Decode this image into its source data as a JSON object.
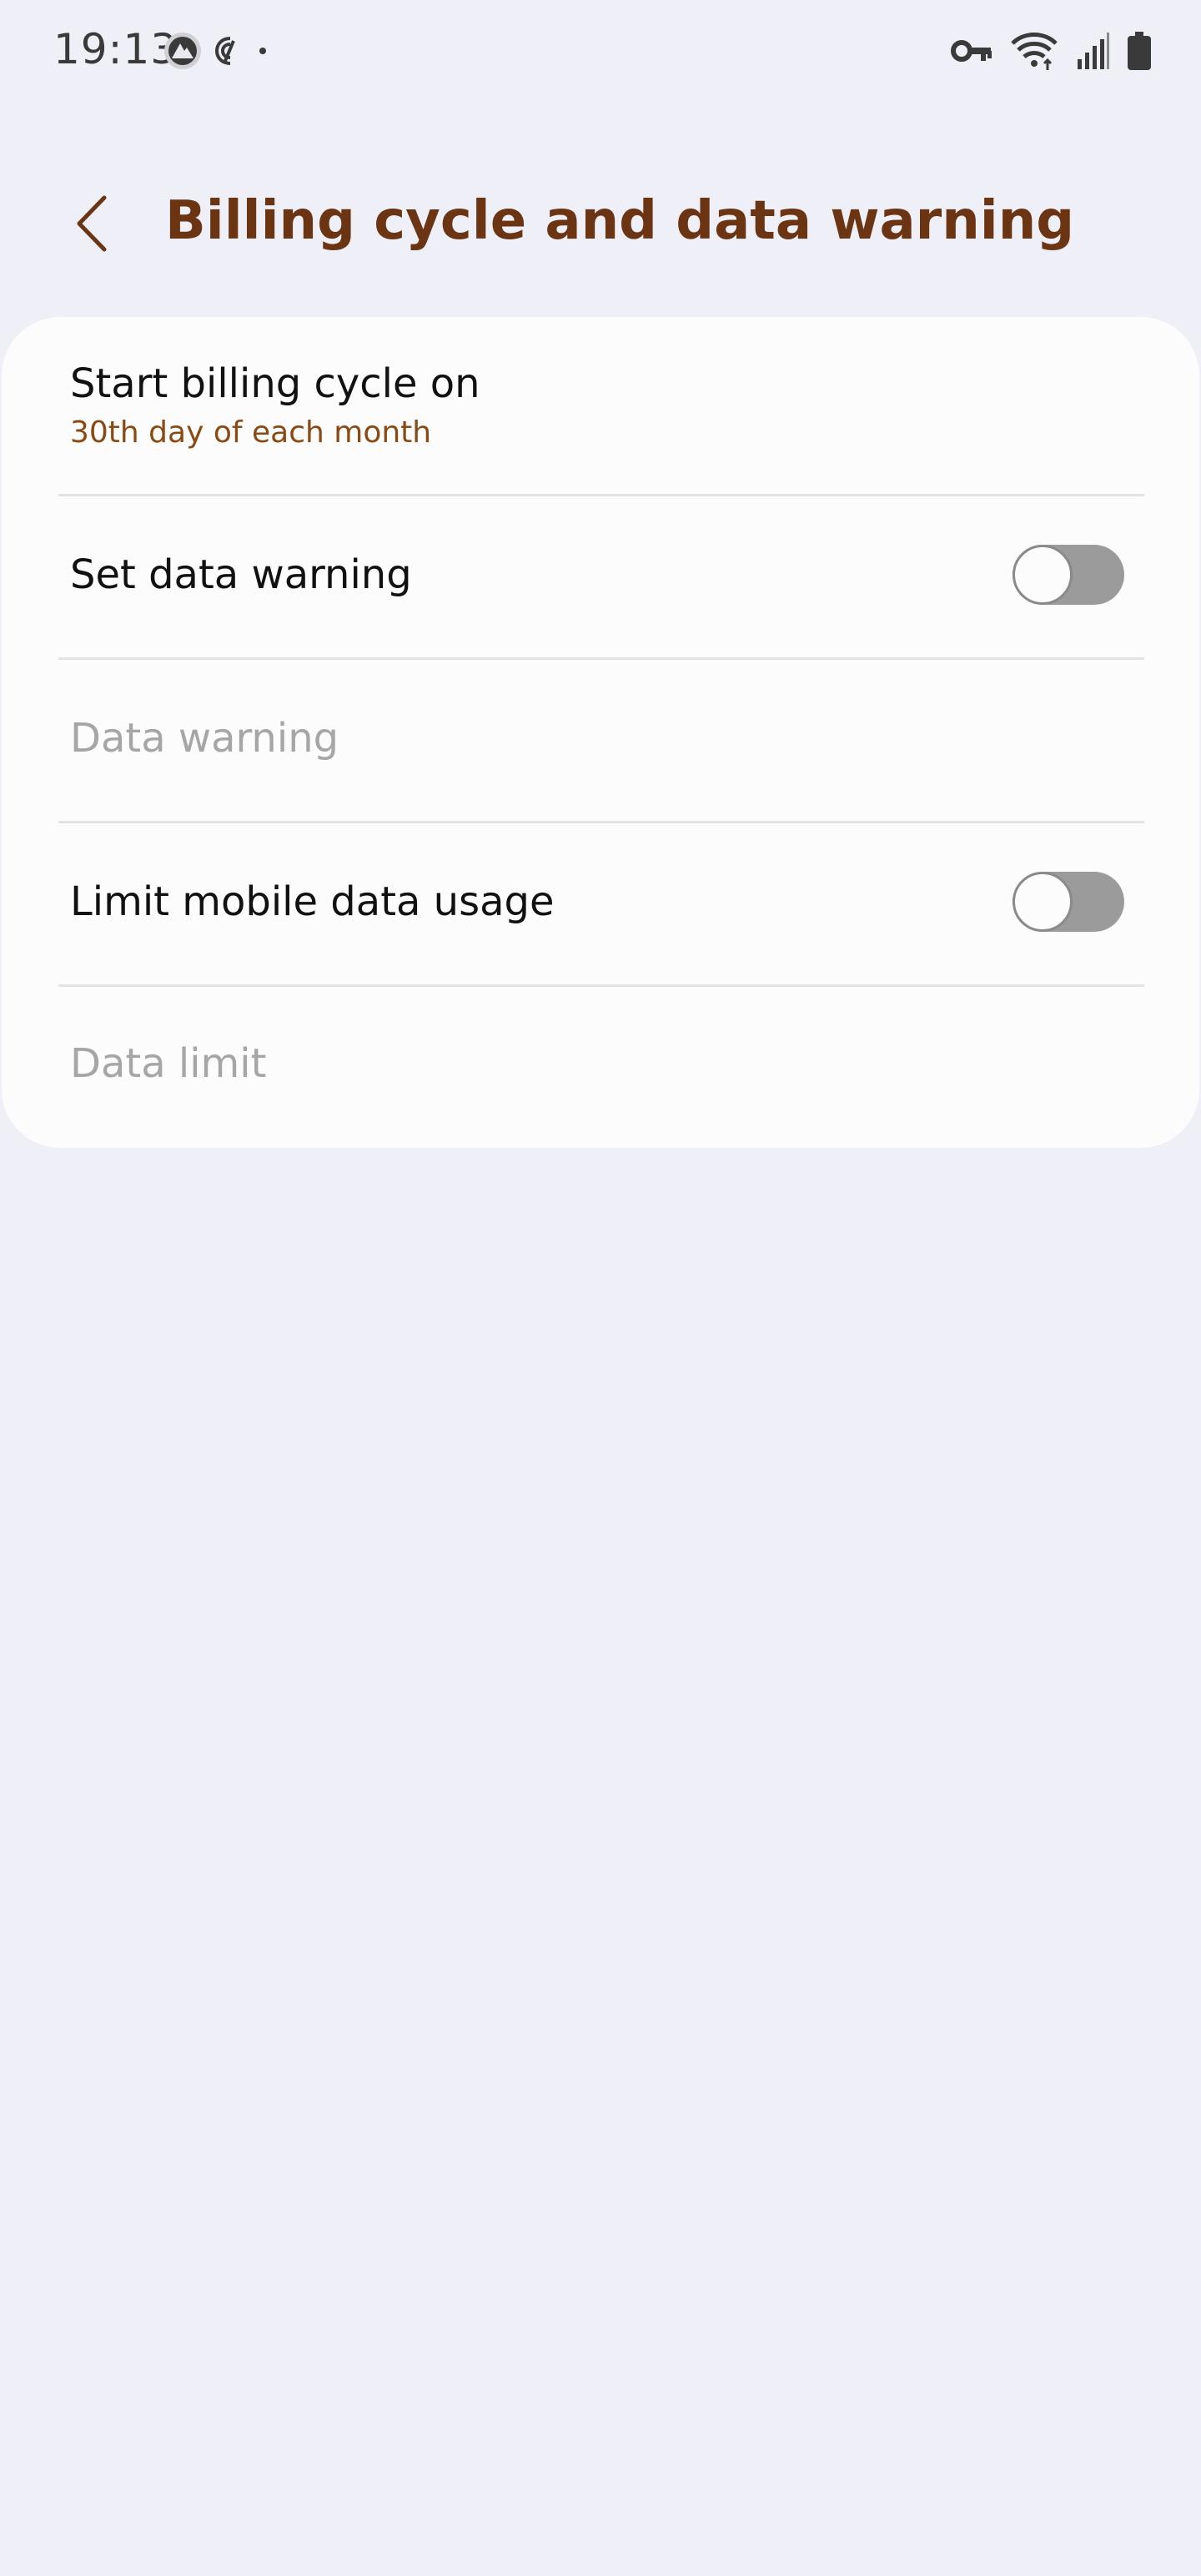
{
  "status_bar": {
    "time": "19:13",
    "left_icons": [
      "nordvpn-icon",
      "privacy-indicator-icon",
      "notification-dot-icon"
    ],
    "right_icons": [
      "vpn-key-icon",
      "wifi-icon",
      "signal-icon",
      "battery-icon"
    ]
  },
  "header": {
    "title": "Billing cycle and data warning"
  },
  "settings": {
    "billing_cycle": {
      "title": "Start billing cycle on",
      "value": "30th day of each month"
    },
    "set_data_warning": {
      "title": "Set data warning",
      "enabled": false
    },
    "data_warning": {
      "title": "Data warning"
    },
    "limit_mobile_data": {
      "title": "Limit mobile data usage",
      "enabled": false
    },
    "data_limit": {
      "title": "Data limit"
    }
  },
  "colors": {
    "accent": "#6b3514",
    "subtitle": "#8a4a14",
    "background": "#efeff7",
    "card": "#fcfcfc",
    "toggle_off": "#9b9b9b"
  }
}
